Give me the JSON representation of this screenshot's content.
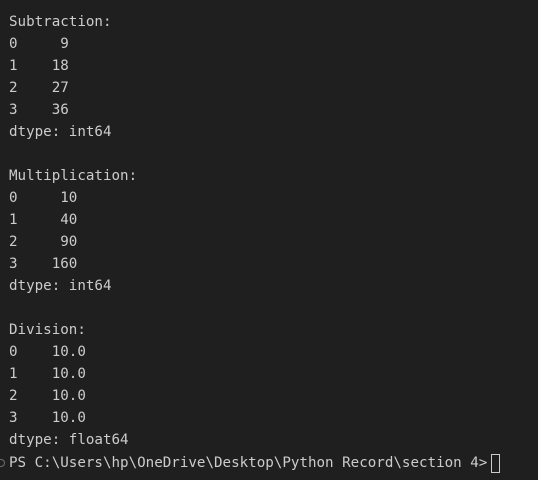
{
  "terminal": {
    "lines": [
      "Subtraction:",
      "0     9",
      "1    18",
      "2    27",
      "3    36",
      "dtype: int64",
      "",
      "Multiplication:",
      "0     10",
      "1     40",
      "2     90",
      "3    160",
      "dtype: int64",
      "",
      "Division:",
      "0    10.0",
      "1    10.0",
      "2    10.0",
      "3    10.0",
      "dtype: float64"
    ],
    "prompt": "PS C:\\Users\\hp\\OneDrive\\Desktop\\Python Record\\section 4>"
  },
  "colors": {
    "background": "#1f1f1f",
    "text": "#cccccc"
  }
}
